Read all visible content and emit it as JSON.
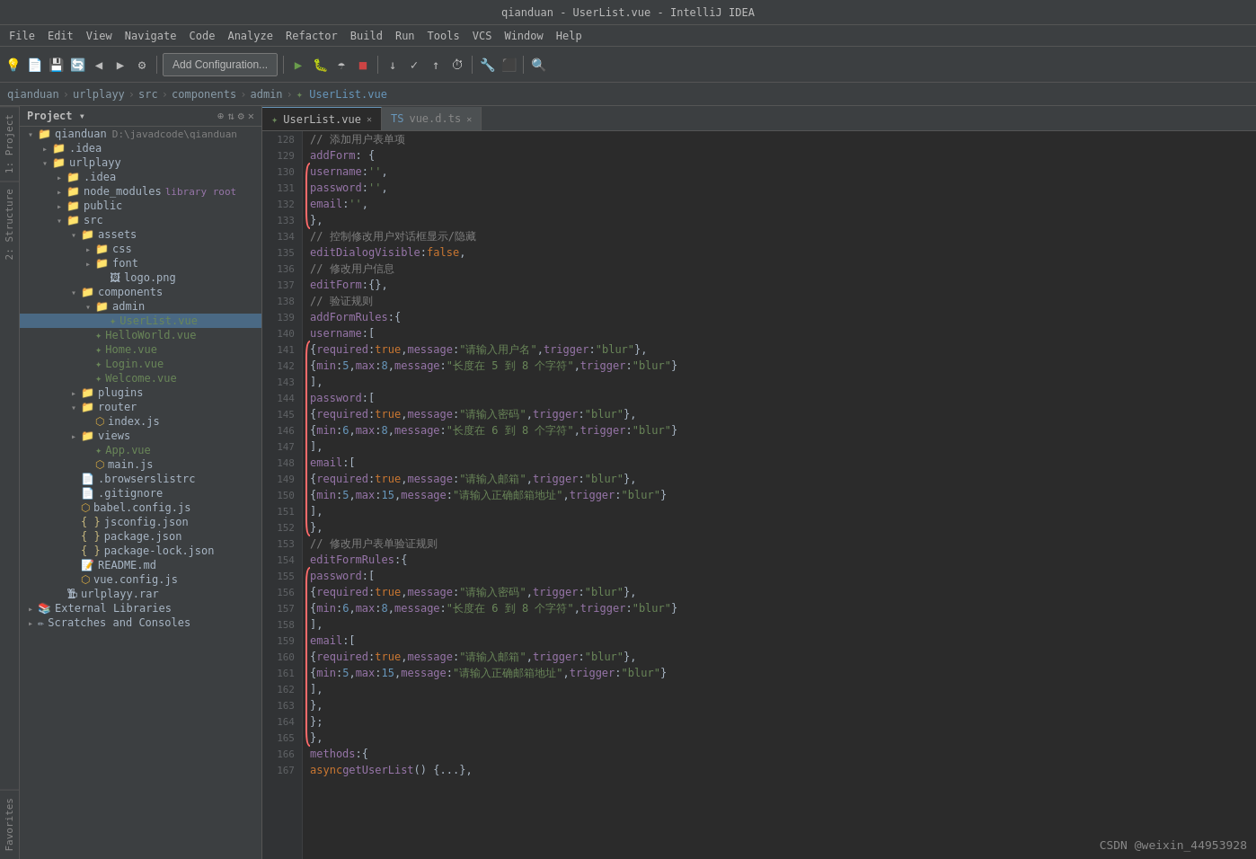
{
  "titleBar": {
    "title": "qianduan - UserList.vue - IntelliJ IDEA"
  },
  "menuBar": {
    "items": [
      "File",
      "Edit",
      "View",
      "Navigate",
      "Code",
      "Analyze",
      "Refactor",
      "Build",
      "Run",
      "Tools",
      "VCS",
      "Window",
      "Help"
    ]
  },
  "toolbar": {
    "addConfig": "Add Configuration..."
  },
  "breadcrumb": {
    "items": [
      "qianduan",
      "urlplayy",
      "src",
      "components",
      "admin",
      "UserList.vue"
    ]
  },
  "sidebar": {
    "title": "Project",
    "tree": [
      {
        "id": "qianduan",
        "label": "qianduan",
        "type": "root",
        "indent": 0,
        "expanded": true,
        "extra": "D:\\javadcode\\qianduan"
      },
      {
        "id": "idea1",
        "label": ".idea",
        "type": "folder",
        "indent": 1,
        "expanded": false
      },
      {
        "id": "urlplayy",
        "label": "urlplayy",
        "type": "folder",
        "indent": 1,
        "expanded": true
      },
      {
        "id": "idea2",
        "label": ".idea",
        "type": "folder",
        "indent": 2,
        "expanded": false
      },
      {
        "id": "node_modules",
        "label": "node_modules",
        "type": "folder-lib",
        "indent": 2,
        "extra": "library root"
      },
      {
        "id": "public",
        "label": "public",
        "type": "folder",
        "indent": 2,
        "expanded": false
      },
      {
        "id": "src",
        "label": "src",
        "type": "folder",
        "indent": 2,
        "expanded": true
      },
      {
        "id": "assets",
        "label": "assets",
        "type": "folder",
        "indent": 3,
        "expanded": true
      },
      {
        "id": "css",
        "label": "css",
        "type": "folder",
        "indent": 4,
        "expanded": false
      },
      {
        "id": "font",
        "label": "font",
        "type": "folder",
        "indent": 4,
        "expanded": false
      },
      {
        "id": "logo",
        "label": "logo.png",
        "type": "image",
        "indent": 4
      },
      {
        "id": "components",
        "label": "components",
        "type": "folder",
        "indent": 3,
        "expanded": true
      },
      {
        "id": "admin",
        "label": "admin",
        "type": "folder",
        "indent": 4,
        "expanded": true
      },
      {
        "id": "userlist",
        "label": "UserList.vue",
        "type": "vue",
        "indent": 5,
        "selected": true
      },
      {
        "id": "helloworld",
        "label": "HelloWorld.vue",
        "type": "vue",
        "indent": 4
      },
      {
        "id": "home",
        "label": "Home.vue",
        "type": "vue",
        "indent": 4
      },
      {
        "id": "login",
        "label": "Login.vue",
        "type": "vue",
        "indent": 4
      },
      {
        "id": "welcome",
        "label": "Welcome.vue",
        "type": "vue",
        "indent": 4
      },
      {
        "id": "plugins",
        "label": "plugins",
        "type": "folder",
        "indent": 3,
        "expanded": false
      },
      {
        "id": "router",
        "label": "router",
        "type": "folder",
        "indent": 3,
        "expanded": true
      },
      {
        "id": "indexjs",
        "label": "index.js",
        "type": "js",
        "indent": 4
      },
      {
        "id": "views",
        "label": "views",
        "type": "folder",
        "indent": 3,
        "expanded": false
      },
      {
        "id": "appvue",
        "label": "App.vue",
        "type": "vue",
        "indent": 3
      },
      {
        "id": "mainjs",
        "label": "main.js",
        "type": "js",
        "indent": 3
      },
      {
        "id": "browserslistrc",
        "label": ".browserslistrc",
        "type": "file",
        "indent": 2
      },
      {
        "id": "gitignore",
        "label": ".gitignore",
        "type": "file",
        "indent": 2
      },
      {
        "id": "babel",
        "label": "babel.config.js",
        "type": "js",
        "indent": 2
      },
      {
        "id": "jsconfig",
        "label": "jsconfig.json",
        "type": "json",
        "indent": 2
      },
      {
        "id": "package",
        "label": "package.json",
        "type": "json",
        "indent": 2
      },
      {
        "id": "packagelock",
        "label": "package-lock.json",
        "type": "json",
        "indent": 2
      },
      {
        "id": "readme",
        "label": "README.md",
        "type": "md",
        "indent": 2
      },
      {
        "id": "vueconfig",
        "label": "vue.config.js",
        "type": "js",
        "indent": 2
      },
      {
        "id": "urlrar",
        "label": "urlplayy.rar",
        "type": "archive",
        "indent": 1
      },
      {
        "id": "extlibs",
        "label": "External Libraries",
        "type": "extlib",
        "indent": 0,
        "expanded": false
      },
      {
        "id": "scratches",
        "label": "Scratches and Consoles",
        "type": "folder",
        "indent": 0,
        "expanded": false
      }
    ]
  },
  "tabs": [
    {
      "label": "UserList.vue",
      "type": "vue",
      "active": true
    },
    {
      "label": "vue.d.ts",
      "type": "ts",
      "active": false
    }
  ],
  "code": {
    "lines": [
      {
        "num": 128,
        "content": "// 添加用户表单项",
        "type": "comment",
        "fold": false
      },
      {
        "num": 129,
        "content": "addForm: {",
        "type": "code",
        "fold": true
      },
      {
        "num": 130,
        "content": "    username:'',",
        "type": "code"
      },
      {
        "num": 131,
        "content": "    password:'',",
        "type": "code"
      },
      {
        "num": 132,
        "content": "    email:'',",
        "type": "code"
      },
      {
        "num": 133,
        "content": "},",
        "type": "code",
        "fold": false
      },
      {
        "num": 134,
        "content": "// 控制修改用户对话框显示/隐藏",
        "type": "comment"
      },
      {
        "num": 135,
        "content": "editDialogVisible:false,",
        "type": "code"
      },
      {
        "num": 136,
        "content": "// 修改用户信息",
        "type": "comment"
      },
      {
        "num": 137,
        "content": "editForm:{},",
        "type": "code"
      },
      {
        "num": 138,
        "content": "// 验证规则",
        "type": "comment"
      },
      {
        "num": 139,
        "content": "addFormRules:{",
        "type": "code",
        "fold": true
      },
      {
        "num": 140,
        "content": "    username:[",
        "type": "code"
      },
      {
        "num": 141,
        "content": "        { required: true, message: \"请输入用户名\", trigger: \"blur\" },",
        "type": "code"
      },
      {
        "num": 142,
        "content": "        { min: 5, max: 8, message: \"长度在 5 到 8 个字符\", trigger: \"blur\" }",
        "type": "code"
      },
      {
        "num": 143,
        "content": "    ],",
        "type": "code"
      },
      {
        "num": 144,
        "content": "    password:[",
        "type": "code"
      },
      {
        "num": 145,
        "content": "        { required: true, message: \"请输入密码\", trigger: \"blur\" },",
        "type": "code"
      },
      {
        "num": 146,
        "content": "        { min: 6, max: 8, message: \"长度在 6 到 8 个字符\", trigger: \"blur\" }",
        "type": "code"
      },
      {
        "num": 147,
        "content": "    ],",
        "type": "code"
      },
      {
        "num": 148,
        "content": "    email:[",
        "type": "code"
      },
      {
        "num": 149,
        "content": "        { required: true, message: \"请输入邮箱\", trigger: \"blur\" },",
        "type": "code"
      },
      {
        "num": 150,
        "content": "        { min: 5, max: 15, message: \"请输入正确邮箱地址\", trigger: \"blur\" }",
        "type": "code"
      },
      {
        "num": 151,
        "content": "    ],",
        "type": "code"
      },
      {
        "num": 152,
        "content": "},",
        "type": "code"
      },
      {
        "num": 153,
        "content": "// 修改用户表单验证规则",
        "type": "comment"
      },
      {
        "num": 154,
        "content": "editFormRules:{",
        "type": "code",
        "fold": true
      },
      {
        "num": 155,
        "content": "    password:[",
        "type": "code"
      },
      {
        "num": 156,
        "content": "        { required: true, message: \"请输入密码\", trigger: \"blur\" },",
        "type": "code"
      },
      {
        "num": 157,
        "content": "        { min: 6, max: 8, message: \"长度在 6 到 8 个字符\", trigger: \"blur\" }",
        "type": "code"
      },
      {
        "num": 158,
        "content": "    ],",
        "type": "code"
      },
      {
        "num": 159,
        "content": "    email:[",
        "type": "code"
      },
      {
        "num": 160,
        "content": "        { required: true, message: \"请输入邮箱\", trigger: \"blur\" },",
        "type": "code"
      },
      {
        "num": 161,
        "content": "        { min: 5, max: 15, message: \"请输入正确邮箱地址\", trigger: \"blur\" }",
        "type": "code"
      },
      {
        "num": 162,
        "content": "    ],",
        "type": "code"
      },
      {
        "num": 163,
        "content": "},",
        "type": "code"
      },
      {
        "num": 164,
        "content": "};",
        "type": "code"
      },
      {
        "num": 165,
        "content": "},",
        "type": "code"
      },
      {
        "num": 166,
        "content": "methods:{",
        "type": "code"
      },
      {
        "num": 167,
        "content": "async getUserList() {...},",
        "type": "code"
      }
    ]
  },
  "watermark": "CSDN @weixin_44953928",
  "sideTabs": [
    "1: Project",
    "2: Structure",
    "Favorites"
  ]
}
